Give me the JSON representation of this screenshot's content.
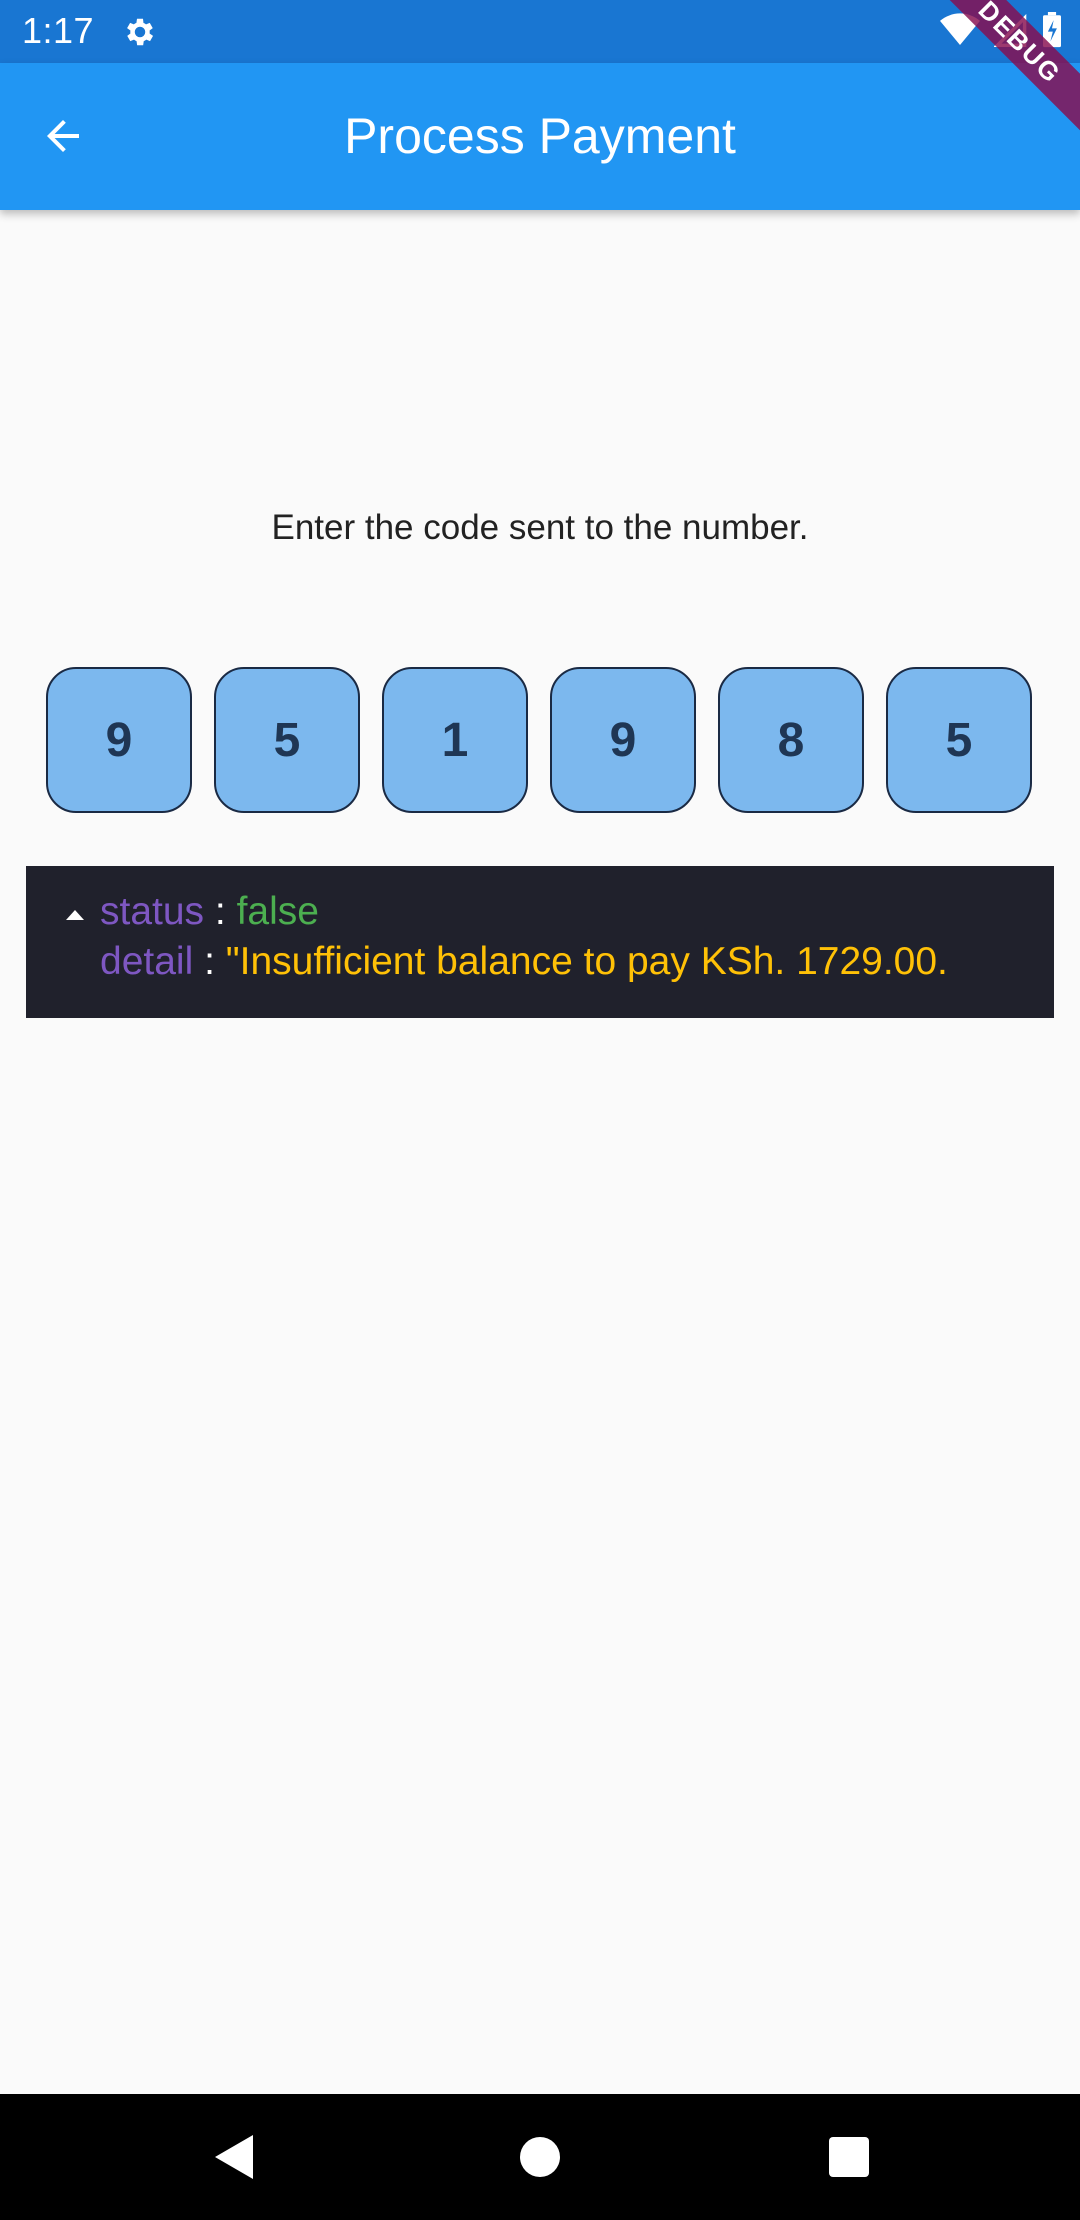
{
  "status_bar": {
    "time": "1:17",
    "icons": [
      "gear-icon",
      "wifi-icon",
      "signal-icon",
      "battery-charging-icon"
    ]
  },
  "app_bar": {
    "back_icon": "arrow-left-icon",
    "title": "Process Payment",
    "debug_banner": "DEBUG"
  },
  "main": {
    "instruction": "Enter the code sent to the number.",
    "code_digits": [
      "9",
      "5",
      "1",
      "9",
      "8",
      "5"
    ]
  },
  "console": {
    "status_key": "status",
    "status_value": "false",
    "detail_key": "detail",
    "detail_value": "\"Insufficient balance to pay KSh. 1729.00.",
    "separator": ":"
  },
  "nav_bar": {
    "icons": [
      "back-triangle-icon",
      "home-circle-icon",
      "recents-square-icon"
    ]
  },
  "colors": {
    "status_bar": "#1976d2",
    "app_bar": "#2196f3",
    "code_box_fill": "#7cb8ee",
    "console_bg": "#20212c",
    "console_key": "#7e57c2",
    "console_bool": "#4caf50",
    "console_string": "#ffc107"
  }
}
